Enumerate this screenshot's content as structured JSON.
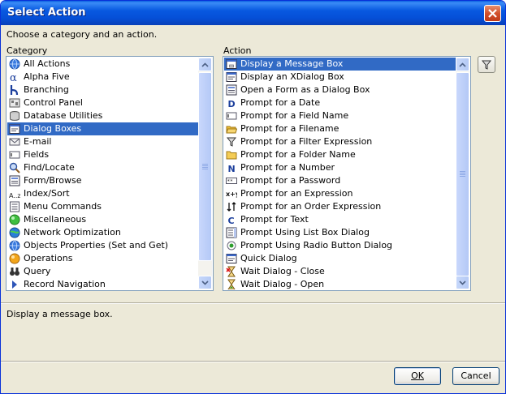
{
  "window": {
    "title": "Select Action"
  },
  "instruction": "Choose a category and an action.",
  "category": {
    "label": "Category",
    "items": [
      {
        "label": "All Actions",
        "icon": "globe-icon"
      },
      {
        "label": "Alpha Five",
        "icon": "alpha-icon"
      },
      {
        "label": "Branching",
        "icon": "branch-icon"
      },
      {
        "label": "Control Panel",
        "icon": "control-panel-icon"
      },
      {
        "label": "Database Utilities",
        "icon": "database-icon"
      },
      {
        "label": "Dialog Boxes",
        "icon": "dialog-icon",
        "selected": true
      },
      {
        "label": "E-mail",
        "icon": "email-icon"
      },
      {
        "label": "Fields",
        "icon": "field-icon"
      },
      {
        "label": "Find/Locate",
        "icon": "find-icon"
      },
      {
        "label": "Form/Browse",
        "icon": "form-icon"
      },
      {
        "label": "Index/Sort",
        "icon": "sort-az-icon"
      },
      {
        "label": "Menu Commands",
        "icon": "menu-icon"
      },
      {
        "label": "Miscellaneous",
        "icon": "misc-icon"
      },
      {
        "label": "Network Optimization",
        "icon": "network-icon"
      },
      {
        "label": "Objects Properties (Set and Get)",
        "icon": "globe-icon"
      },
      {
        "label": "Operations",
        "icon": "operations-icon"
      },
      {
        "label": "Query",
        "icon": "binoculars-icon"
      },
      {
        "label": "Record Navigation",
        "icon": "arrow-right-icon"
      }
    ]
  },
  "action": {
    "label": "Action",
    "items": [
      {
        "label": "Display a Message Box",
        "icon": "message-box-icon",
        "selected": true
      },
      {
        "label": "Display an XDialog Box",
        "icon": "dialog-icon"
      },
      {
        "label": "Open a Form as a Dialog Box",
        "icon": "form-icon"
      },
      {
        "label": "Prompt for a Date",
        "icon": "letter-d-icon"
      },
      {
        "label": "Prompt for a Field Name",
        "icon": "field-icon"
      },
      {
        "label": "Prompt for a Filename",
        "icon": "folder-open-icon"
      },
      {
        "label": "Prompt for a Filter Expression",
        "icon": "filter-icon"
      },
      {
        "label": "Prompt for a Folder Name",
        "icon": "folder-icon"
      },
      {
        "label": "Prompt for a Number",
        "icon": "letter-n-icon"
      },
      {
        "label": "Prompt for a Password",
        "icon": "password-icon"
      },
      {
        "label": "Prompt for an Expression",
        "icon": "expression-icon"
      },
      {
        "label": "Prompt for an Order Expression",
        "icon": "order-icon"
      },
      {
        "label": "Prompt for Text",
        "icon": "letter-c-icon"
      },
      {
        "label": "Prompt Using List Box Dialog",
        "icon": "listbox-icon"
      },
      {
        "label": "Prompt Using Radio Button Dialog",
        "icon": "radio-icon"
      },
      {
        "label": "Quick Dialog",
        "icon": "dialog-icon"
      },
      {
        "label": "Wait Dialog - Close",
        "icon": "hourglass-close-icon"
      },
      {
        "label": "Wait Dialog - Open",
        "icon": "hourglass-icon"
      }
    ]
  },
  "description": "Display a message box.",
  "buttons": {
    "ok": "OK",
    "cancel": "Cancel"
  },
  "colors": {
    "selection": "#316ac5",
    "titlebar": "#0554d8",
    "dialog_bg": "#ece9d8"
  }
}
